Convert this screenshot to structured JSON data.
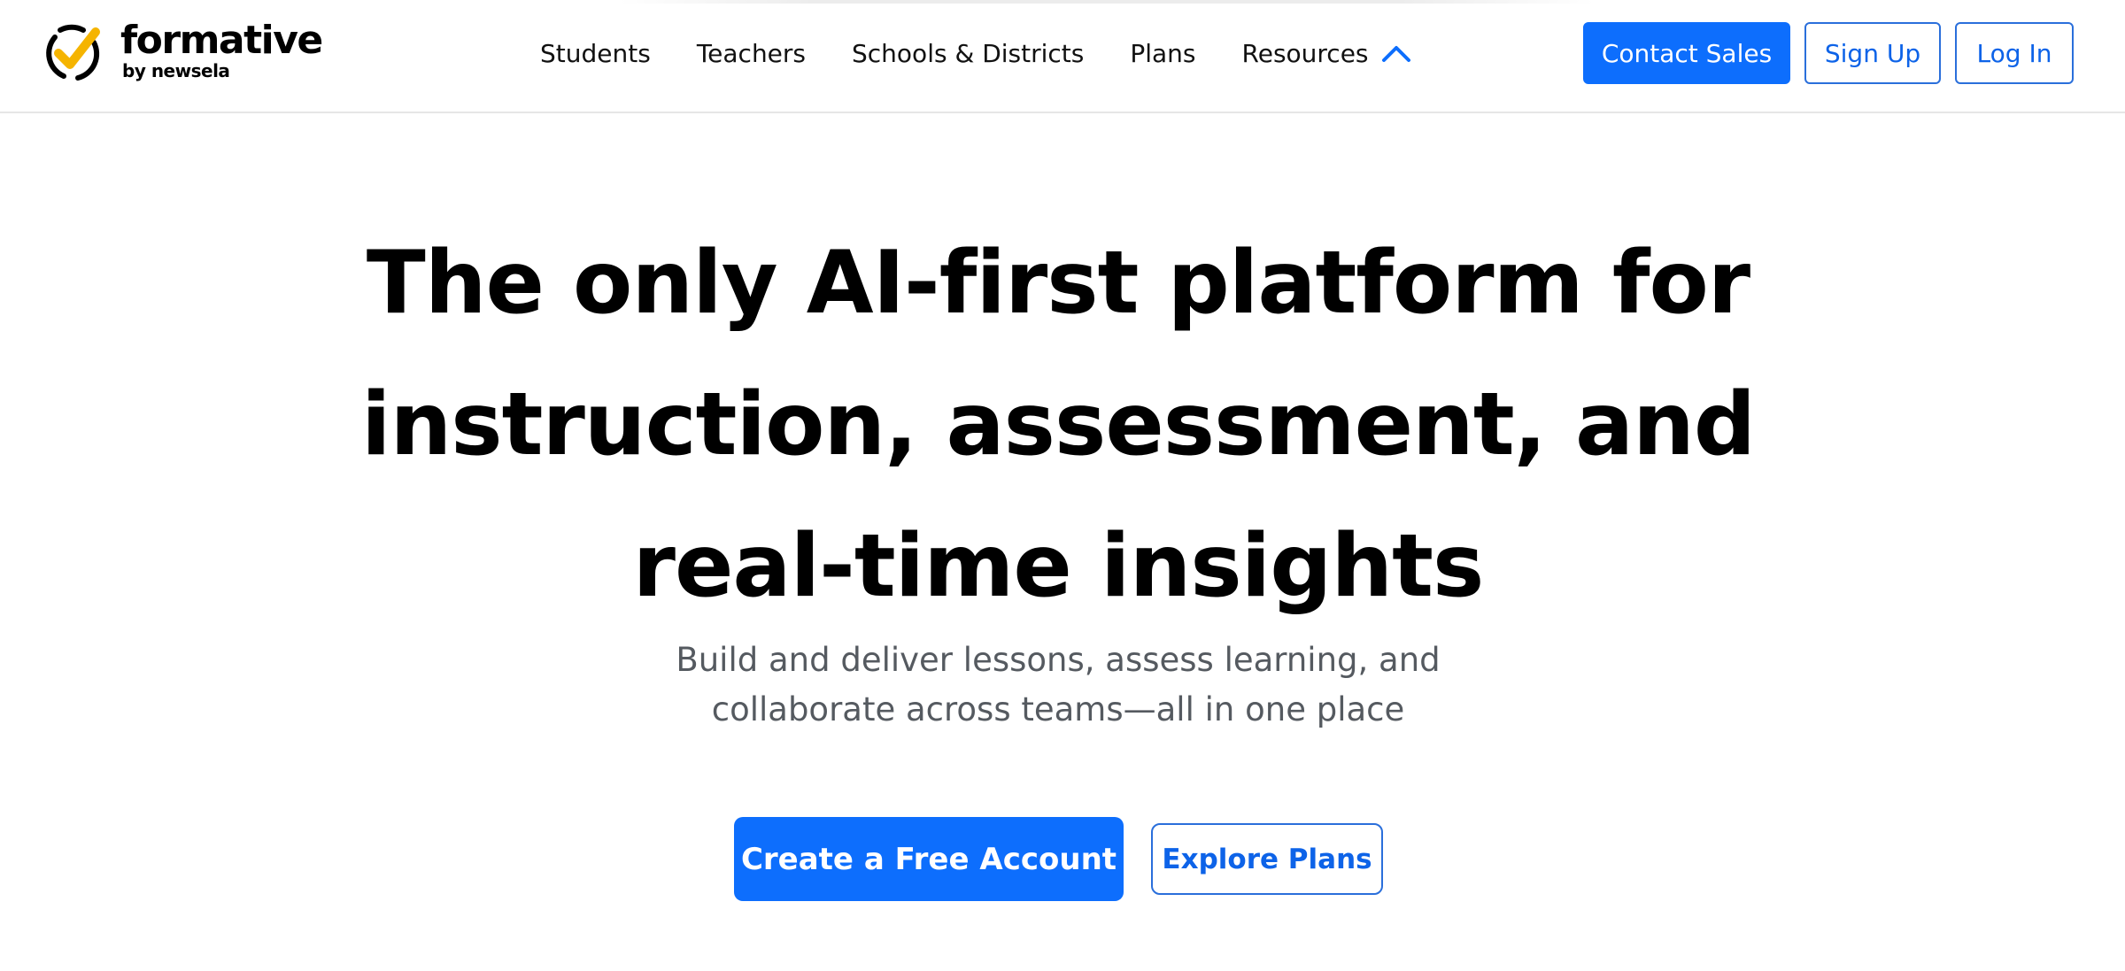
{
  "brand": {
    "name": "formative",
    "tagline": "by newsela",
    "colors": {
      "check": "#f5b400",
      "ring": "#000000",
      "accent": "#0d6efd"
    }
  },
  "nav": {
    "items": [
      {
        "label": "Students"
      },
      {
        "label": "Teachers"
      },
      {
        "label": "Schools & Districts"
      },
      {
        "label": "Plans"
      },
      {
        "label": "Resources",
        "icon": "chevron-up-icon",
        "expanded": true
      }
    ]
  },
  "header_actions": {
    "contact_sales": "Contact Sales",
    "sign_up": "Sign Up",
    "log_in": "Log In"
  },
  "hero": {
    "title_lines": [
      "The only AI-first platform for",
      "instruction, assessment, and",
      "real-time insights"
    ],
    "subtitle_lines": [
      "Build and deliver lessons, assess learning, and",
      "collaborate across teams—all in one place"
    ],
    "primary_cta": "Create a Free Account",
    "secondary_cta": "Explore Plans"
  }
}
